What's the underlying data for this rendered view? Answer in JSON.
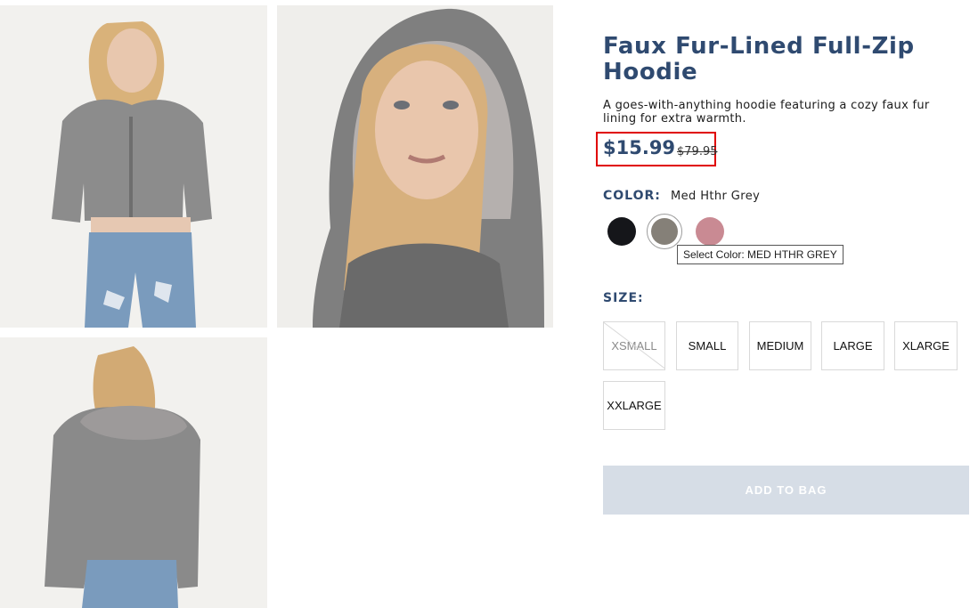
{
  "product": {
    "title": "Faux Fur-Lined Full-Zip Hoodie",
    "description": "A goes-with-anything hoodie featuring a cozy faux fur lining for extra warmth.",
    "price": "$15.99",
    "original_price": "$79.95"
  },
  "color": {
    "label": "COLOR:",
    "selected": "Med Hthr Grey",
    "swatches": [
      {
        "name": "black",
        "hex": "#15161a"
      },
      {
        "name": "med-hthr-grey",
        "hex": "#858078"
      },
      {
        "name": "pink",
        "hex": "#c98a93"
      }
    ],
    "tooltip": "Select Color: MED HTHR GREY"
  },
  "size": {
    "label": "SIZE:",
    "options": [
      "XSMALL",
      "SMALL",
      "MEDIUM",
      "LARGE",
      "XLARGE",
      "XXLARGE"
    ],
    "unavailable": [
      "XSMALL"
    ]
  },
  "actions": {
    "add_to_bag": "ADD TO BAG"
  },
  "colors": {
    "accent": "#2f4a70",
    "price_highlight_border": "#e00000",
    "disabled_button": "#d6dde6"
  }
}
